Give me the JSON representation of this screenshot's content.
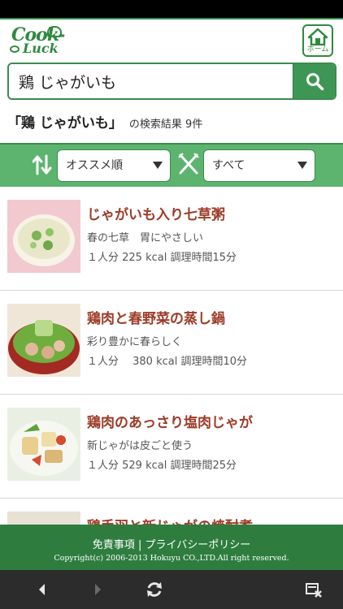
{
  "header": {
    "logo_text_top": "Cook-",
    "logo_text_bottom": "Luck",
    "home_label": "ホーム"
  },
  "search": {
    "value": "鶏 じゃがいも"
  },
  "result": {
    "query": "「鶏 じゃがいも」",
    "count_text": "の検索結果 9件"
  },
  "filters": {
    "sort_value": "オススメ順",
    "category_value": "すべて"
  },
  "recipes": [
    {
      "title": "じゃがいも入り七草粥",
      "description": "春の七草　胃にやさしい",
      "meta": "１人分 225 kcal 調理時間15分"
    },
    {
      "title": "鶏肉と春野菜の蒸し鍋",
      "description": "彩り豊かに春らしく",
      "meta": "１人分　 380 kcal 調理時間10分"
    },
    {
      "title": "鶏肉のあっさり塩肉じゃが",
      "description": "新じゃがは皮ごと使う",
      "meta": "１人分 529 kcal 調理時間25分"
    },
    {
      "title": "鶏手羽と新じゃがの焼酎煮",
      "description": "",
      "meta": ""
    }
  ],
  "footer": {
    "disclaimer": "免責事項",
    "separator": "|",
    "privacy": "プライバシーポリシー",
    "copyright": "Copyright(c) 2006-2013 Hokuyu CO.,LTD.All right reserved."
  },
  "colors": {
    "brand_green": "#2f8a3e",
    "filter_green": "#5cb46f",
    "title_red": "#9c3b27"
  }
}
